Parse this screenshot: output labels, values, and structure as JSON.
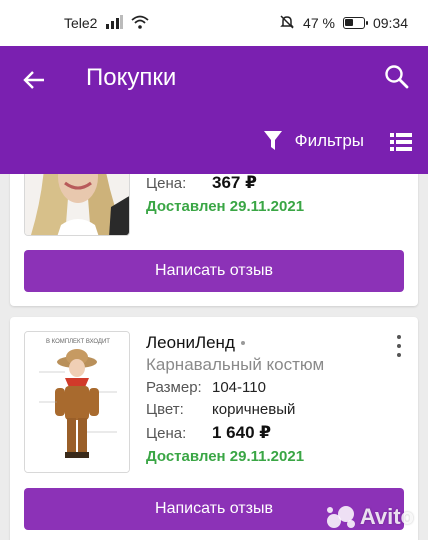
{
  "status_bar": {
    "carrier": "Tele2",
    "battery_percent": "47 %",
    "time": "09:34"
  },
  "app_bar": {
    "title": "Покупки",
    "filters_label": "Фильтры"
  },
  "purchases": [
    {
      "fields": [
        {
          "label": "Цена:",
          "value": "367 ₽"
        }
      ],
      "status": "Доставлен 29.11.2021",
      "review_button": "Написать отзыв"
    },
    {
      "brand": "ЛеониЛенд",
      "product": "Карнавальный костюм",
      "fields": [
        {
          "label": "Размер:",
          "value": "104-110"
        },
        {
          "label": "Цвет:",
          "value": "коричневый"
        },
        {
          "label": "Цена:",
          "value": "1 640 ₽"
        }
      ],
      "status": "Доставлен 29.11.2021",
      "review_button": "Написать отзыв",
      "image_caption": "В КОМПЛЕКТ ВХОДИТ"
    }
  ],
  "watermark": "Avito",
  "colors": {
    "app_bar": "#7a20b0",
    "button": "#8c32b7",
    "delivered": "#3aa645"
  }
}
